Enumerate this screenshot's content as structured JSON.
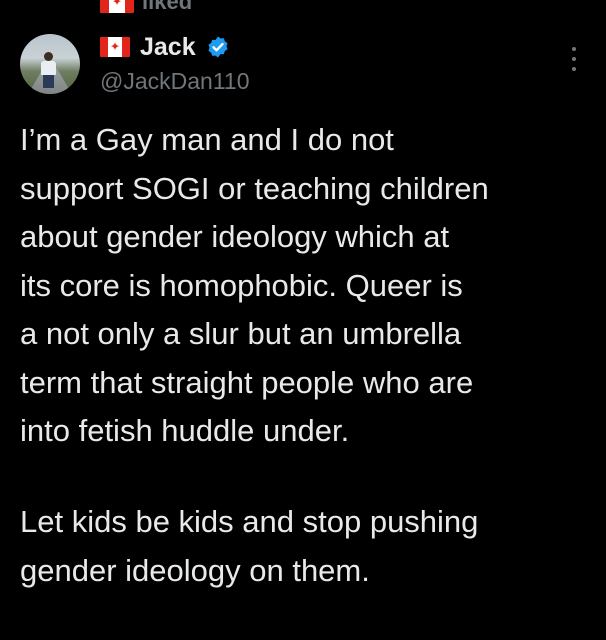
{
  "social_context": {
    "text": "liked",
    "flag_icon": "canada-flag-icon"
  },
  "author": {
    "display_name": "Jack",
    "handle": "@JackDan110",
    "verified": true,
    "verified_color": "#1d9bf0",
    "name_flag_icon": "canada-flag-icon",
    "avatar_icon": "profile-photo-person-on-road"
  },
  "menu": {
    "icon": "more-vertical-icon"
  },
  "tweet": {
    "paragraph_1": "I’m a Gay man and I do not\nsupport SOGI or teaching children\nabout gender ideology which at\nits core is homophobic. Queer is\na not only a slur but an umbrella\nterm that straight people who are\ninto fetish huddle under.",
    "paragraph_2": "Let kids be kids and stop pushing\ngender ideology on them."
  },
  "colors": {
    "background": "#000000",
    "primary_text": "#e7e9ea",
    "secondary_text": "#71767b",
    "flag_red": "#e1251b"
  }
}
